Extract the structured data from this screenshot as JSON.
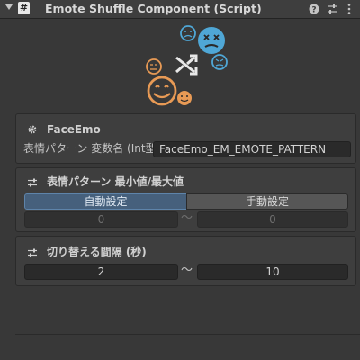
{
  "header": {
    "title": "Emote Shuffle Component (Script)",
    "script_icon_glyph": "#"
  },
  "sections": {
    "faceemo": {
      "title": "FaceEmo",
      "param_label": "表情パターン 変数名 (Int型)",
      "param_value": "FaceEmo_EM_EMOTE_PATTERN"
    },
    "range": {
      "title": "表情パターン 最小値/最大値",
      "mode_auto": "自動設定",
      "mode_manual": "手動設定",
      "min": "0",
      "max": "0",
      "separator": "〜"
    },
    "interval": {
      "title": "切り替える間隔 (秒)",
      "min": "2",
      "max": "10",
      "separator": "〜"
    }
  },
  "colors": {
    "background": "#383838",
    "active_segment": "#46607c",
    "face_orange": "#e89a55",
    "face_blue": "#4fa7d6"
  }
}
